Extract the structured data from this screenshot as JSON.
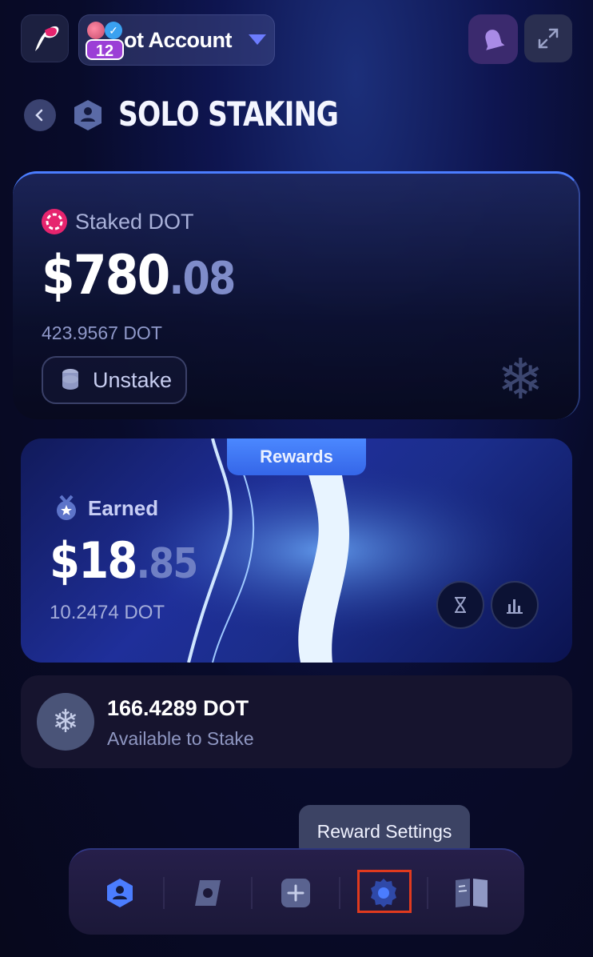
{
  "header": {
    "account_name": "ot Account",
    "account_badge": "12"
  },
  "title": {
    "text": "SOLO STAKING"
  },
  "staked": {
    "label": "Staked DOT",
    "amount_main": "$780",
    "amount_decimal": ".08",
    "dot_amount": "423.9567 DOT",
    "unstake_label": "Unstake"
  },
  "rewards": {
    "tab_label": "Rewards",
    "earned_label": "Earned",
    "amount_main": "$18",
    "amount_decimal": ".85",
    "dot_amount": "10.2474 DOT"
  },
  "available": {
    "amount": "166.4289 DOT",
    "label": "Available to Stake"
  },
  "tooltip": {
    "text": "Reward Settings"
  },
  "colors": {
    "accent": "#4b7dff",
    "polkadot_pink": "#e6246e",
    "highlight": "#e03a1e"
  },
  "icons": [
    "logo-icon",
    "bell-icon",
    "expand-icon",
    "back-icon",
    "user-shield-icon",
    "polkadot-icon",
    "coins-icon",
    "snowflake-icon",
    "medal-icon",
    "hourglass-icon",
    "chart-icon",
    "nav-user-icon",
    "nav-pools-icon",
    "nav-add-icon",
    "nav-settings-icon",
    "nav-book-icon"
  ]
}
